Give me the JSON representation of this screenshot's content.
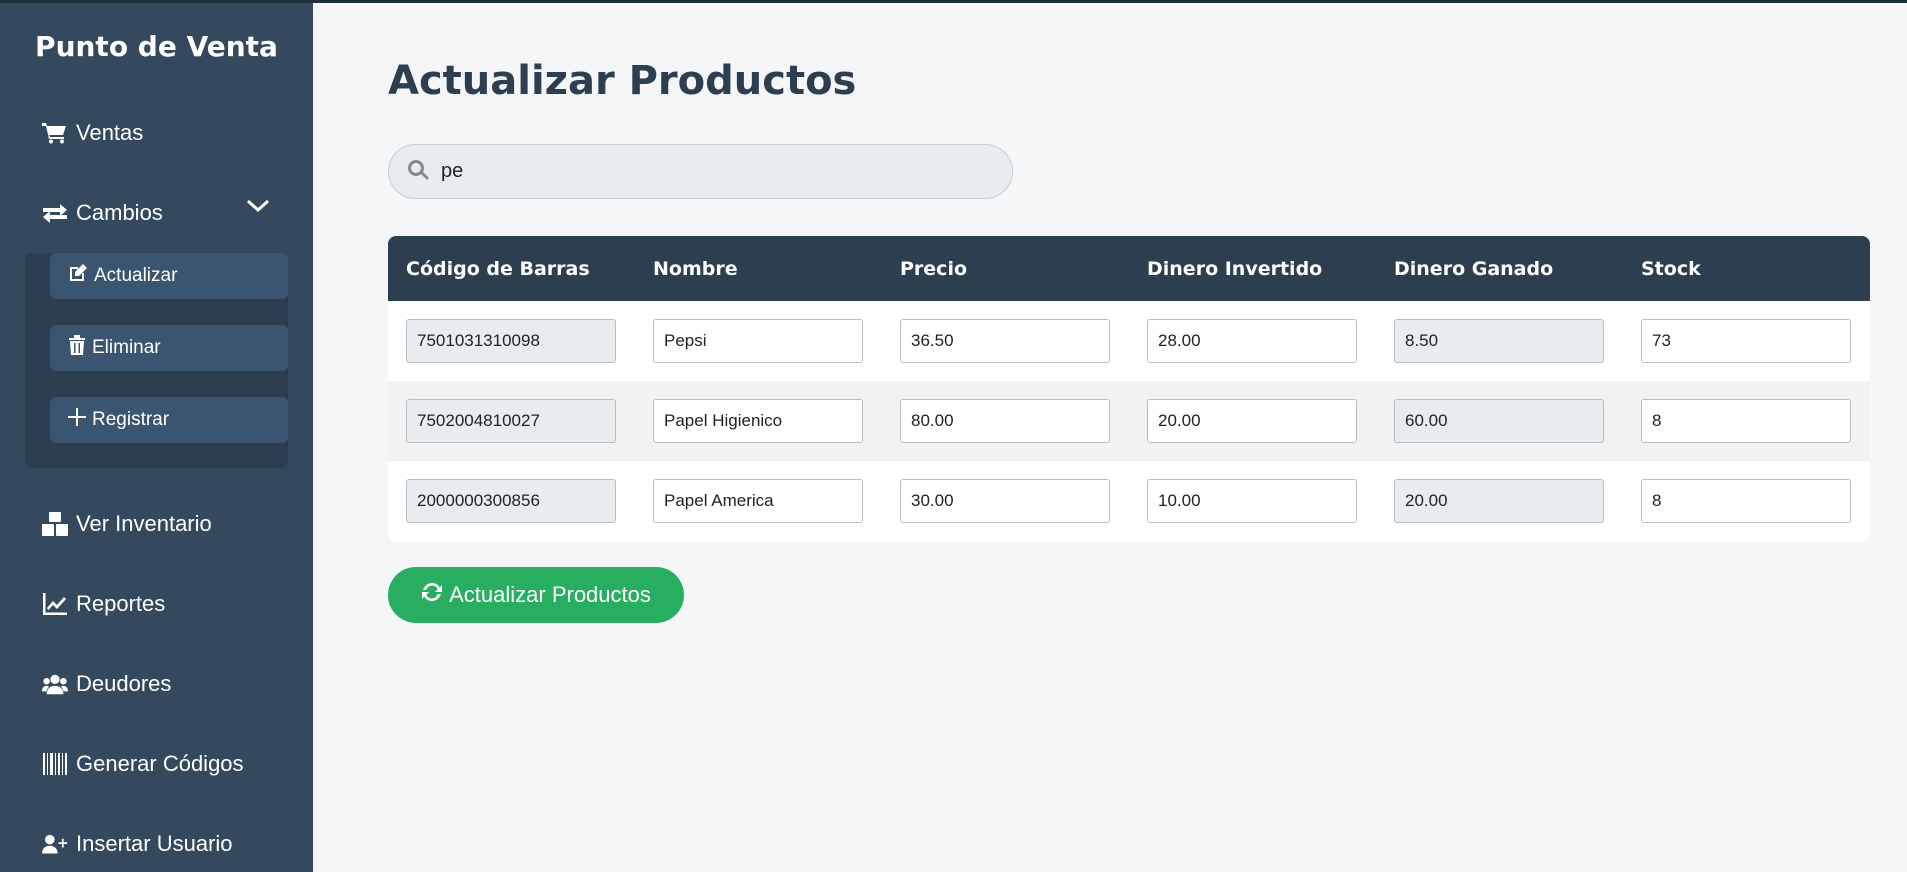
{
  "app": {
    "brand": "Punto de Venta"
  },
  "sidebar": {
    "items": [
      {
        "label": "Ventas",
        "icon": "cart-icon"
      },
      {
        "label": "Cambios",
        "icon": "exchange-icon"
      },
      {
        "label": "Ver Inventario",
        "icon": "boxes-icon"
      },
      {
        "label": "Reportes",
        "icon": "chart-line-icon"
      },
      {
        "label": "Deudores",
        "icon": "users-icon"
      },
      {
        "label": "Generar Códigos",
        "icon": "barcode-icon"
      },
      {
        "label": "Insertar Usuario",
        "icon": "user-plus-icon"
      }
    ],
    "submenu": [
      {
        "label": "Actualizar",
        "icon": "edit-icon"
      },
      {
        "label": "Eliminar",
        "icon": "trash-icon"
      },
      {
        "label": "Registrar",
        "icon": "plus-icon"
      }
    ]
  },
  "main": {
    "title": "Actualizar Productos",
    "search": {
      "value": "pe",
      "icon": "search-icon"
    },
    "table": {
      "headers": [
        "Código de Barras",
        "Nombre",
        "Precio",
        "Dinero Invertido",
        "Dinero Ganado",
        "Stock"
      ],
      "rows": [
        [
          "7501031310098",
          "Pepsi",
          "36.50",
          "28.00",
          "8.50",
          "73"
        ],
        [
          "7502004810027",
          "Papel Higienico",
          "80.00",
          "20.00",
          "60.00",
          "8"
        ],
        [
          "2000000300856",
          "Papel America",
          "30.00",
          "10.00",
          "20.00",
          "8"
        ]
      ]
    },
    "update_button": {
      "label": "Actualizar Productos",
      "icon": "refresh-icon"
    }
  },
  "colors": {
    "sidebar_bg": "#34495e",
    "header_bg": "#2c3e50",
    "accent_green": "#27ae60",
    "page_bg": "#f4f6f8"
  }
}
